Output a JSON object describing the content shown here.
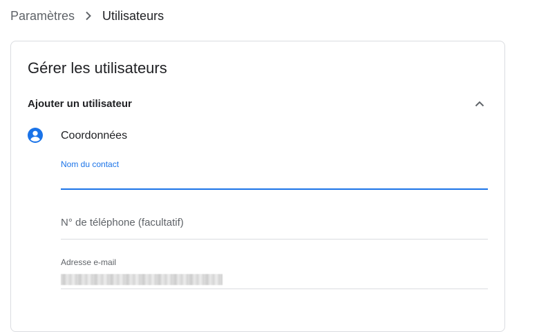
{
  "breadcrumb": {
    "parent": "Paramètres",
    "current": "Utilisateurs"
  },
  "card": {
    "title": "Gérer les utilisateurs",
    "section": {
      "title": "Ajouter un utilisateur",
      "collapse_icon": "chevron-up-icon",
      "subsection": {
        "title": "Coordonnées",
        "icon": "account-circle-icon"
      },
      "fields": {
        "contact_name": {
          "label": "Nom du contact",
          "value": ""
        },
        "phone": {
          "placeholder": "N° de téléphone (facultatif)",
          "value": ""
        },
        "email": {
          "label": "Adresse e-mail"
        }
      }
    }
  },
  "colors": {
    "accent": "#1a73e8",
    "text_primary": "#202124",
    "text_secondary": "#5f6368",
    "divider": "#dadce0"
  }
}
